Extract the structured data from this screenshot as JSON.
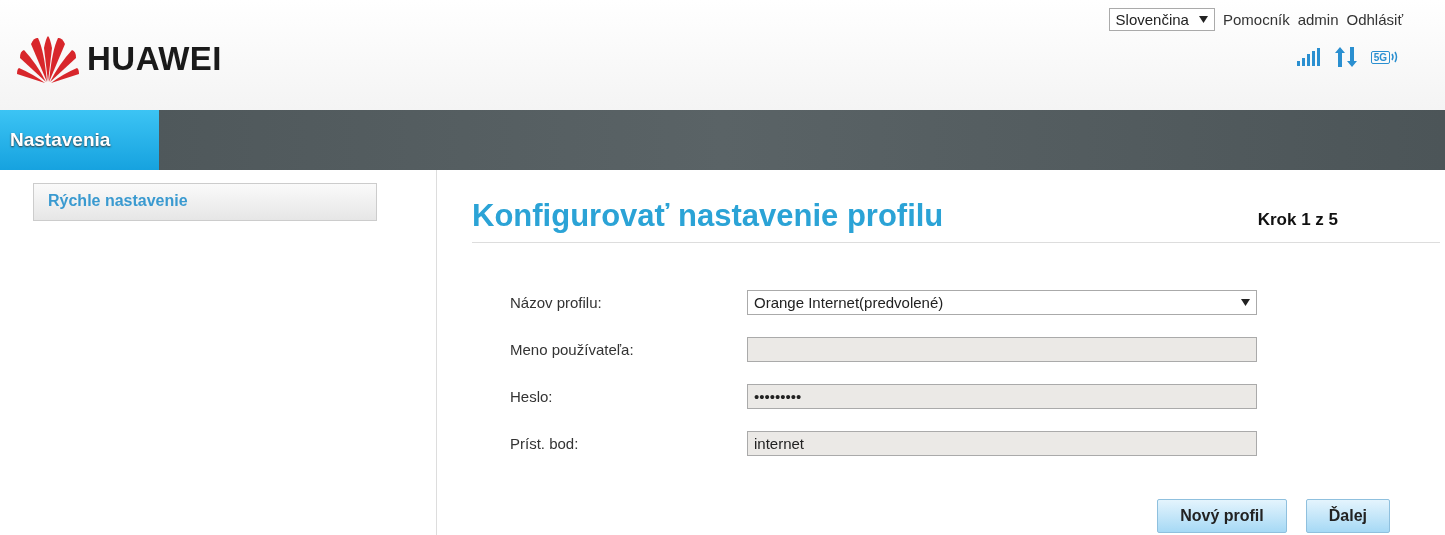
{
  "header": {
    "brand": "HUAWEI",
    "language": "Slovenčina",
    "links": [
      "Pomocník",
      "admin",
      "Odhlásiť"
    ],
    "network_badge": "5G"
  },
  "nav": {
    "tabs": [
      {
        "label": "Nastavenia",
        "selected": true
      }
    ]
  },
  "sidebar": {
    "items": [
      {
        "label": "Rýchle nastavenie",
        "selected": true
      }
    ]
  },
  "main": {
    "title": "Konfigurovať nastavenie profilu",
    "step": "Krok 1 z 5",
    "fields": [
      {
        "label": "Názov profilu:",
        "kind": "select",
        "value": "Orange Internet(predvolené)",
        "disabled": false
      },
      {
        "label": "Meno používateľa:",
        "kind": "input",
        "disabled": true
      },
      {
        "label": "Heslo:",
        "kind": "input",
        "value": "•••••••••",
        "disabled": true
      },
      {
        "label": "Príst. bod:",
        "kind": "input",
        "value": "internet",
        "disabled": true
      }
    ],
    "buttons": [
      "Nový profil",
      "Ďalej"
    ]
  }
}
